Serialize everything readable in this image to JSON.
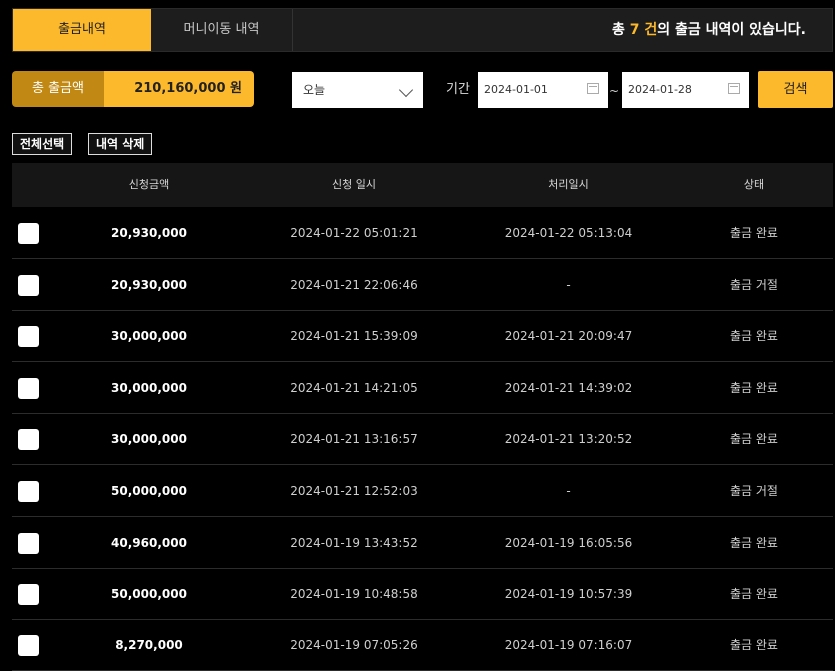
{
  "tabs": {
    "active": "출금내역",
    "inactive": "머니이동 내역"
  },
  "summary": {
    "prefix": "총",
    "count": "7 건",
    "suffix": "의 출금 내역이 있습니다."
  },
  "total": {
    "label": "총 출금액",
    "value": "210,160,000 원"
  },
  "filter": {
    "period_select": "오늘",
    "period_label": "기간",
    "start_date": "2024-01-01",
    "tilde": "~",
    "end_date": "2024-01-28",
    "search_label": "검색"
  },
  "actions": {
    "select_all": "전체선택",
    "delete": "내역 삭제"
  },
  "table": {
    "headers": [
      "신청금액",
      "신청 일시",
      "처리일시",
      "상태"
    ],
    "rows": [
      {
        "amount": "20,930,000",
        "requested": "2024-01-22 05:01:21",
        "processed": "2024-01-22 05:13:04",
        "status": "출금 완료"
      },
      {
        "amount": "20,930,000",
        "requested": "2024-01-21 22:06:46",
        "processed": "-",
        "status": "출금 거절"
      },
      {
        "amount": "30,000,000",
        "requested": "2024-01-21 15:39:09",
        "processed": "2024-01-21 20:09:47",
        "status": "출금 완료"
      },
      {
        "amount": "30,000,000",
        "requested": "2024-01-21 14:21:05",
        "processed": "2024-01-21 14:39:02",
        "status": "출금 완료"
      },
      {
        "amount": "30,000,000",
        "requested": "2024-01-21 13:16:57",
        "processed": "2024-01-21 13:20:52",
        "status": "출금 완료"
      },
      {
        "amount": "50,000,000",
        "requested": "2024-01-21 12:52:03",
        "processed": "-",
        "status": "출금 거절"
      },
      {
        "amount": "40,960,000",
        "requested": "2024-01-19 13:43:52",
        "processed": "2024-01-19 16:05:56",
        "status": "출금 완료"
      },
      {
        "amount": "50,000,000",
        "requested": "2024-01-19 10:48:58",
        "processed": "2024-01-19 10:57:39",
        "status": "출금 완료"
      },
      {
        "amount": "8,270,000",
        "requested": "2024-01-19 07:05:26",
        "processed": "2024-01-19 07:16:07",
        "status": "출금 완료"
      }
    ]
  },
  "colors": {
    "accent": "#fdb92c",
    "accent_dark": "#c18913",
    "background": "#000000"
  },
  "icons": {
    "dropdown": "chevron-down-icon",
    "date": "calendar-icon"
  }
}
